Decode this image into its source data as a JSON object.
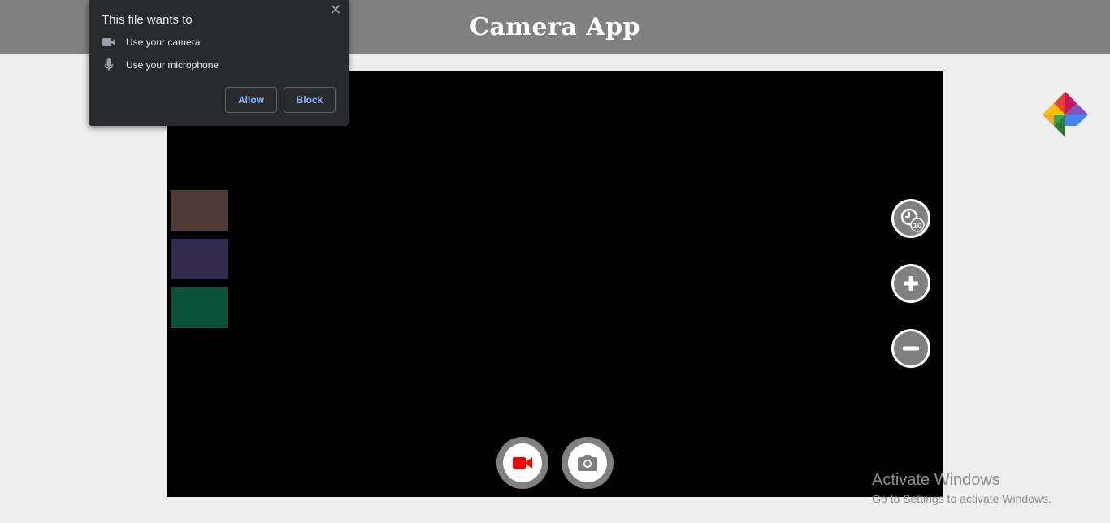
{
  "header": {
    "title": "Camera App"
  },
  "permission_popup": {
    "title": "This file wants to",
    "close_icon": "close-icon",
    "permissions": [
      {
        "icon": "video-camera-icon",
        "label": "Use your camera"
      },
      {
        "icon": "microphone-icon",
        "label": "Use your microphone"
      }
    ],
    "allow_label": "Allow",
    "block_label": "Block"
  },
  "filters": {
    "swatches": [
      {
        "name": "brown-filter",
        "color": "#4f3a35"
      },
      {
        "name": "purple-filter",
        "color": "#332c4e"
      },
      {
        "name": "green-filter",
        "color": "#0c513a"
      }
    ]
  },
  "controls": {
    "timer_icon": "timer-icon",
    "timer_badge": "10",
    "zoom_in_icon": "plus-icon",
    "zoom_out_icon": "minus-icon",
    "record_icon": "video-camera-icon",
    "record_color": "#ff0000",
    "capture_icon": "camera-icon"
  },
  "gallery": {
    "icon": "gallery-pinwheel-icon"
  },
  "watermark": {
    "title": "Activate Windows",
    "subtitle": "Go to Settings to activate Windows."
  },
  "colors": {
    "header_bg": "#808080",
    "page_bg": "#eeeeee",
    "video_bg": "#000000",
    "popup_bg": "#292a2d",
    "popup_button_text": "#8ab4f8"
  }
}
